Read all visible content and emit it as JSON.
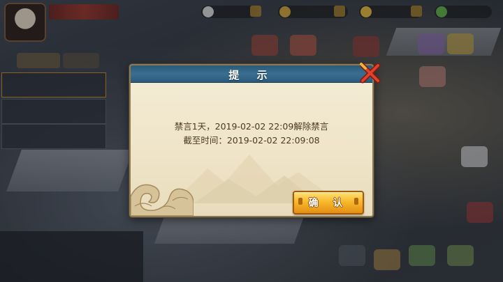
{
  "dialog": {
    "title": "提 示",
    "message_line1": "禁言1天，2019-02-02 22:09解除禁言",
    "message_line2": "截至时间：2019-02-02 22:09:08",
    "confirm_label": "确 认",
    "close_icon": "close-x-icon"
  },
  "colors": {
    "title_bar": "#3a6f91",
    "parchment": "#efe4c8",
    "confirm_button": "#f8b92b",
    "message_text": "#4a3a22"
  }
}
